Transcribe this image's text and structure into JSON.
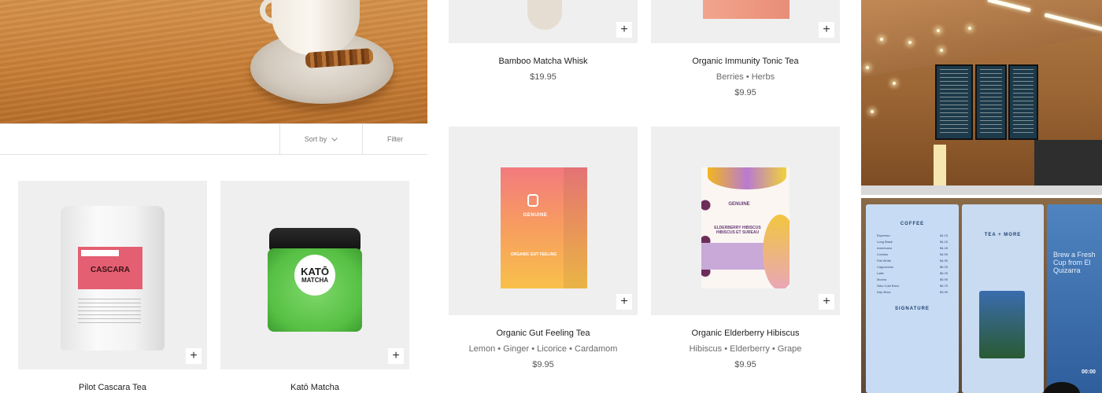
{
  "toolbar": {
    "sort_label": "Sort by",
    "filter_label": "Filter"
  },
  "products_left": [
    {
      "name": "Pilot Cascara Tea",
      "package_title": "CASCARA",
      "package_brand": "PILOT COFFEE ROASTERS"
    },
    {
      "name": "Katō Matcha",
      "package_title": "KATŌ",
      "package_subtitle": "MATCHA"
    }
  ],
  "products_right": [
    {
      "name": "Bamboo Matcha Whisk",
      "subtitle": "",
      "price": "$19.95"
    },
    {
      "name": "Organic Immunity Tonic Tea",
      "subtitle": "Berries • Herbs",
      "price": "$9.95"
    },
    {
      "name": "Organic Gut Feeling Tea",
      "subtitle": "Lemon • Ginger • Licorice • Cardamom",
      "price": "$9.95",
      "package_brand": "GENUINE",
      "package_title": "ORGANIC GUT FEELING"
    },
    {
      "name": "Organic Elderberry Hibiscus",
      "subtitle": "Hibiscus • Elderberry • Grape",
      "price": "$9.95",
      "package_brand": "GENUINE",
      "package_title": "ELDERBERRY HIBISCUS",
      "package_title_fr": "HIBISCUS ET SUREAU"
    }
  ],
  "add_button_symbol": "+",
  "photo_menu": {
    "coffee_header": "COFFEE",
    "coffee_items": [
      {
        "item": "Espresso",
        "price": "$4.15"
      },
      {
        "item": "Long Black",
        "price": "$4.15"
      },
      {
        "item": "Americano",
        "price": "$4.45"
      },
      {
        "item": "Cortado",
        "price": "$4.95"
      },
      {
        "item": "Flat White",
        "price": "$4.95"
      },
      {
        "item": "Cappuccino",
        "price": "$5.25"
      },
      {
        "item": "Latte",
        "price": "$5.25"
      },
      {
        "item": "Mocha",
        "price": "$5.95"
      },
      {
        "item": "Nitro Cold Brew",
        "price": "$5.75"
      },
      {
        "item": "Drip Brew",
        "price": "$3.95"
      }
    ],
    "tea_header": "TEA + MORE",
    "signature_header": "SIGNATURE",
    "cta_text": "Brew a Fresh Cup from El Quizarra",
    "clock": "00:00"
  },
  "colors": {
    "accent": "#1a1a1a",
    "tile_bg": "#efefef",
    "border": "#e2e2e2"
  }
}
